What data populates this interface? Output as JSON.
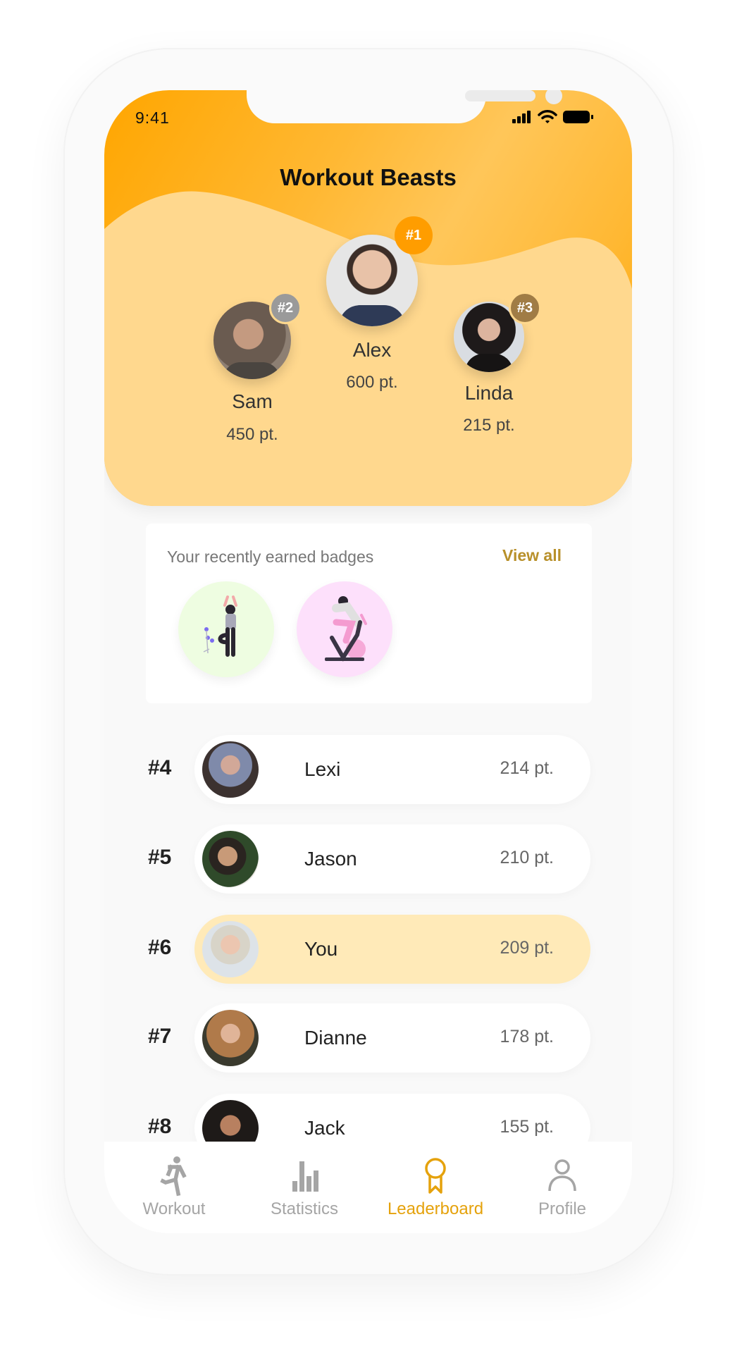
{
  "status_bar": {
    "time": "9:41",
    "icons": [
      "signal-icon",
      "wifi-icon",
      "battery-icon"
    ]
  },
  "header": {
    "title": "Workout Beasts"
  },
  "colors": {
    "accent": "#ffa600",
    "active_tab": "#e5a20c",
    "highlight_row": "#ffeab8",
    "view_all": "#b8902a",
    "rank1": "#ff9d00",
    "rank2": "#9a9a9a",
    "rank3": "#a07c45"
  },
  "podium": [
    {
      "rank": "#1",
      "name": "Alex",
      "points": "600 pt."
    },
    {
      "rank": "#2",
      "name": "Sam",
      "points": "450 pt."
    },
    {
      "rank": "#3",
      "name": "Linda",
      "points": "215 pt."
    }
  ],
  "badges": {
    "title": "Your recently earned badges",
    "view_all": "View all",
    "items": [
      {
        "name": "yoga-badge"
      },
      {
        "name": "cycling-badge"
      }
    ]
  },
  "leaderboard": [
    {
      "rank": "#4",
      "name": "Lexi",
      "points": "214 pt."
    },
    {
      "rank": "#5",
      "name": "Jason",
      "points": "210 pt."
    },
    {
      "rank": "#6",
      "name": "You",
      "points": "209 pt.",
      "is_current_user": true
    },
    {
      "rank": "#7",
      "name": "Dianne",
      "points": "178 pt."
    },
    {
      "rank": "#8",
      "name": "Jack",
      "points": "155 pt."
    }
  ],
  "tabbar": {
    "active": "Leaderboard",
    "tabs": [
      {
        "label": "Workout",
        "icon": "running-icon"
      },
      {
        "label": "Statistics",
        "icon": "bar-chart-icon"
      },
      {
        "label": "Leaderboard",
        "icon": "award-ribbon-icon"
      },
      {
        "label": "Profile",
        "icon": "user-icon"
      }
    ]
  }
}
